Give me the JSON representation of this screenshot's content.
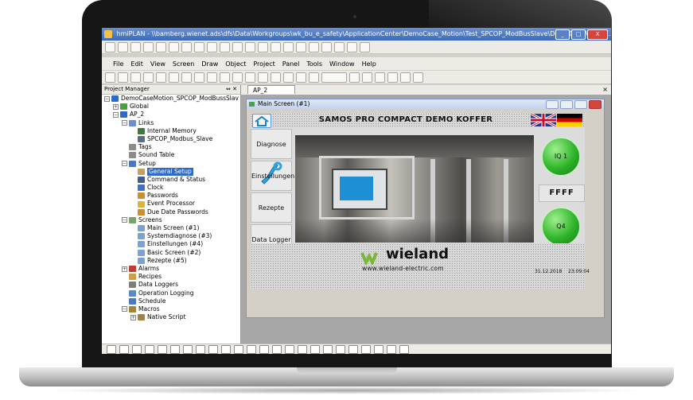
{
  "window": {
    "title": "hmiPLAN - \\\\bamberg.wienet.ads\\dfs\\Data\\Workgroups\\wk_bu_e_safety\\ApplicationCenter\\DemoCase_Motion\\Test_SPCOP_ModBusSlave\\DemoCaseMotion...",
    "minimize": "_",
    "maximize": "□",
    "close": "X"
  },
  "menu": [
    "File",
    "Edit",
    "View",
    "Screen",
    "Draw",
    "Object",
    "Project",
    "Panel",
    "Tools",
    "Window",
    "Help"
  ],
  "project_manager": {
    "title": "Project Manager",
    "pin": "⇔ ✕",
    "tree": [
      {
        "label": "DemoCaseMotion_SPCOP_ModBussSlav",
        "depth": 0,
        "toggle": "−",
        "icon_color": "#2f6bc2"
      },
      {
        "label": "Global",
        "depth": 1,
        "toggle": "+",
        "icon_color": "#4b9d3d"
      },
      {
        "label": "AP_2",
        "depth": 1,
        "toggle": "−",
        "icon_color": "#2f6bc2"
      },
      {
        "label": "Links",
        "depth": 2,
        "toggle": "−",
        "icon_color": "#6c8fc9"
      },
      {
        "label": "Internal Memory",
        "depth": 3,
        "toggle": "",
        "icon_color": "#3c7a3a"
      },
      {
        "label": "SPCOP_Modbus_Slave",
        "depth": 3,
        "toggle": "",
        "icon_color": "#5a6c86"
      },
      {
        "label": "Tags",
        "depth": 2,
        "toggle": "",
        "icon_color": "#8b8b8b"
      },
      {
        "label": "Sound Table",
        "depth": 2,
        "toggle": "",
        "icon_color": "#8b8b8b"
      },
      {
        "label": "Setup",
        "depth": 2,
        "toggle": "−",
        "icon_color": "#4c78c0"
      },
      {
        "label": "General Setup",
        "depth": 3,
        "toggle": "",
        "icon_color": "#c6a25a",
        "selected": true
      },
      {
        "label": "Command & Status",
        "depth": 3,
        "toggle": "",
        "icon_color": "#3d5f8e"
      },
      {
        "label": "Clock",
        "depth": 3,
        "toggle": "",
        "icon_color": "#3c73c4"
      },
      {
        "label": "Passwords",
        "depth": 3,
        "toggle": "",
        "icon_color": "#d08c2f"
      },
      {
        "label": "Event Processor",
        "depth": 3,
        "toggle": "",
        "icon_color": "#e0b433"
      },
      {
        "label": "Due Date Passwords",
        "depth": 3,
        "toggle": "",
        "icon_color": "#d08c2f"
      },
      {
        "label": "Screens",
        "depth": 2,
        "toggle": "−",
        "icon_color": "#7da36d"
      },
      {
        "label": "Main Screen (#1)",
        "depth": 3,
        "toggle": "",
        "icon_color": "#7aa2d6"
      },
      {
        "label": "Systemdiagnose (#3)",
        "depth": 3,
        "toggle": "",
        "icon_color": "#7aa2d6"
      },
      {
        "label": "Einstellungen (#4)",
        "depth": 3,
        "toggle": "",
        "icon_color": "#7aa2d6"
      },
      {
        "label": "Basic Screen (#2)",
        "depth": 3,
        "toggle": "",
        "icon_color": "#7aa2d6"
      },
      {
        "label": "Rezepte (#5)",
        "depth": 3,
        "toggle": "",
        "icon_color": "#7aa2d6"
      },
      {
        "label": "Alarms",
        "depth": 2,
        "toggle": "+",
        "icon_color": "#c43a34"
      },
      {
        "label": "Recipes",
        "depth": 2,
        "toggle": "",
        "icon_color": "#c9a044"
      },
      {
        "label": "Data Loggers",
        "depth": 2,
        "toggle": "",
        "icon_color": "#7f7f7f"
      },
      {
        "label": "Operation Logging",
        "depth": 2,
        "toggle": "",
        "icon_color": "#5a8ac8"
      },
      {
        "label": "Schedule",
        "depth": 2,
        "toggle": "",
        "icon_color": "#4c78c0"
      },
      {
        "label": "Macros",
        "depth": 2,
        "toggle": "−",
        "icon_color": "#a0843f"
      },
      {
        "label": "Native Script",
        "depth": 3,
        "toggle": "+",
        "icon_color": "#a0843f"
      }
    ]
  },
  "document": {
    "tab_label": "AP_2",
    "tab_close": "×"
  },
  "hmi_window": {
    "title": "Main Screen (#1)",
    "banner_title": "SAMOS PRO COMPACT DEMO KOFFER",
    "side_buttons": [
      "Diagnose",
      "Einstellungen",
      "Rezepte",
      "Data Logger"
    ],
    "indicator_top": "IQ 1",
    "hex_value": "FFFF",
    "indicator_bottom": "Q4",
    "logo_text": "wieland",
    "logo_url": "www.wieland-electric.com",
    "date": "31.12.2018",
    "time": "23:09:04"
  },
  "colors": {
    "accent_blue": "#316ac5",
    "indicator_green": "#2fb52a",
    "logo_green": "#79b83a"
  }
}
